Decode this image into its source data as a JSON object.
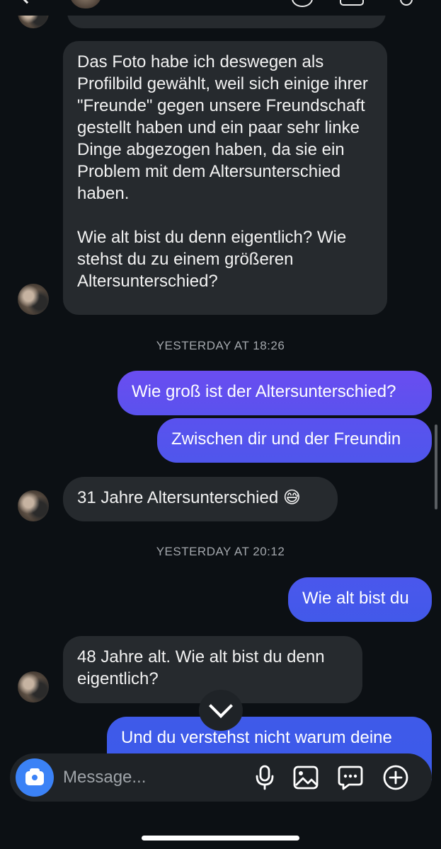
{
  "messages": {
    "incoming_1_p1": "Das Foto habe ich deswegen als Profilbild gewählt, weil sich einige ihrer \"Freunde\" gegen unsere Freundschaft gestellt haben und ein paar sehr linke Dinge abgezogen haben, da sie ein Problem mit dem Altersunterschied haben.",
    "incoming_1_p2": "Wie alt bist du denn eigentlich? Wie stehst du zu einem größeren Altersunterschied?",
    "timestamp_1": "YESTERDAY AT 18:26",
    "outgoing_1": "Wie groß ist der Altersunterschied?",
    "outgoing_2": "Zwischen dir und der Freundin",
    "incoming_2": "31 Jahre Altersunterschied 😅",
    "timestamp_2": "YESTERDAY AT 20:12",
    "outgoing_3": "Wie alt bist du",
    "incoming_3": "48 Jahre alt. Wie alt bist du denn eigentlich?",
    "outgoing_4": "Und du verstehst nicht warum deine"
  },
  "composer": {
    "placeholder": "Message..."
  },
  "colors": {
    "background": "#0c1014",
    "incoming_bubble": "#262a2e",
    "outgoing_gradient_top": "#6a4df0",
    "outgoing_gradient_bottom": "#3b5bea",
    "camera_button": "#3b82f6"
  },
  "icons": {
    "camera": "camera-icon",
    "mic": "microphone-icon",
    "gallery": "image-icon",
    "sticker": "chat-bubble-icon",
    "add": "plus-circle-icon",
    "scroll": "chevron-down-icon"
  }
}
